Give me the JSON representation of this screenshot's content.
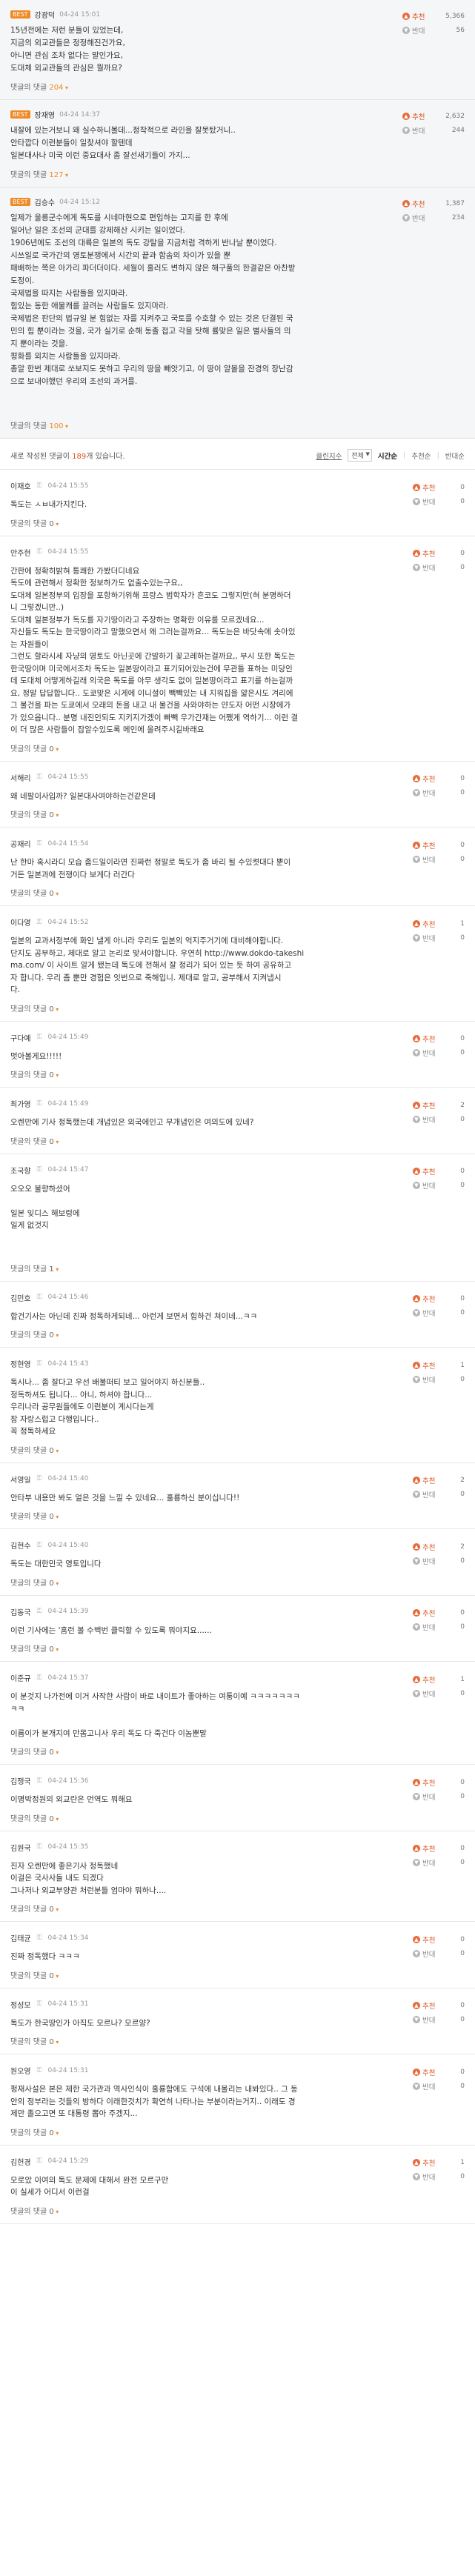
{
  "icons": {
    "lock": "lock-icon",
    "up": "thumb-up-icon",
    "down": "thumb-down-icon",
    "arrow": "arrow-down-icon"
  },
  "colors": {
    "accent": "#d9531e",
    "best_badge": "#f08a24"
  },
  "best_replies": [
    {
      "badge": "BEST",
      "user": "강광덕",
      "date": "04-24 15:01",
      "lines": [
        "15년전에는 저런 분들이 있었는데,",
        "지금의 외교관들은 정정해진건가요,",
        "아니면 관심 조차 없다는 말인가요,",
        "도대체 외교관들의 관심은 뭘까요? "
      ],
      "reply_label": "댓글의 댓글",
      "reply_count": "204",
      "up_label": "추천",
      "up": "5,366",
      "down_label": "반대",
      "down": "56"
    },
    {
      "badge": "BEST",
      "user": "장재영",
      "date": "04-24 14:37",
      "lines": [
        "내잘에 있는거보니 왜 실수하니볼데...정착적으로 라인을 잘못탔거니..",
        "안타깝다 이런분들이 일찾셔야 할텐데",
        "일본대사나 미국 이런 중요대사 좀 잘선새기들이 가지... "
      ],
      "reply_label": "댓글의 댓글",
      "reply_count": "127",
      "up_label": "추천",
      "up": "2,632",
      "down_label": "반대",
      "down": "244"
    },
    {
      "badge": "BEST",
      "user": "김승수",
      "date": "04-24 15:12",
      "lines": [
        "일제가 울릉군수에게 독도를 시네마현으로 편입하는 고지를 한 후에",
        "일어난 일은 조선의 군대를 강제해산 시키는 일이었다.",
        "1906년에도 조선의 대륙은 일본의 독도 강탈을 지금처럼 격하게 반나날 뿐이었다.",
        "시쓰일로 국가간의 영토분쟁에서 시간의 끝과 함솜의 차이가 있을 뿐",
        "패배하는 쪽은 아가리 파더더이다. 세월이 흘러도 변하지 않은 해구풀의 한결같은 아찬받",
        "도정이.",
        "국제법을 따지는 사람들을 있지마라.",
        "힘있는 동한 애물캐를 끌려는 사람들도 있지마라.",
        "국제법은 판단의 법규일 분 힘없는 자를 지켜주고 국토를 수호할 수 있는 것은 단결된 국",
        "민의 힘 뿐이라는 것을, 국가 실기로 순해 동졸 접고 각을 탓해 률맞은 일은 별사들의 의",
        "지 뿐이라는 것을.",
        "평화를 외치는 사람들을 있지마라.",
        "총알 한번 제대로 쏘보지도 못하고 우리의 땅을 빼앗기고, 이 땅이 알몰을 잔경의 장난감",
        "으로 보내야했던 우리의 조선의 과거를.",
        "",
        ""
      ],
      "reply_label": "댓글의 댓글",
      "reply_count": "100",
      "up_label": "추천",
      "up": "1,387",
      "down_label": "반대",
      "down": "234"
    }
  ],
  "sortbar": {
    "prefix": "새로 작성된 댓글이",
    "count": "189",
    "suffix": "개 있습니다.",
    "cleanbot": "클린지수",
    "filter": "전체",
    "opt1": "시간순",
    "opt2": "추천순",
    "opt3": "반대순"
  },
  "replies": [
    {
      "user": "이재호",
      "date": "04-24 15:55",
      "lines": [
        "독도는 ㅅㅂ내가지킨다. "
      ],
      "reply": "댓글의 댓글 0",
      "up": "0",
      "down": "0"
    },
    {
      "user": "안주현",
      "date": "04-24 15:55",
      "lines": [
        "간판에 정확히밝혀 통쾌한 가봤더디네요",
        "독도에 관련해서 정확한 정보하가도 없출수있는구요,,",
        "도대체 일본정부의 입장을 포항하기위해 프랑스 범학자가 흔코도 그렇지만(혀 분명하더",
        "니 그렇겠니만..)",
        "도대체 일본정부가 독도를 자기땅이라고 주장하는 명확한 이유를 모르겠네요...",
        "자신들도 독도는 한국땅이라고 말했으면서 왜 그러는걸까요... 독도는은 바닷속에 솟아있",
        "는 자원들이",
        "그런도 할라시세 자냥의 영토도 아닌곳에 간발하기 꽂고레하는걸까요,, 부시 또한 독도는",
        "한국땅이며 미국에서조차 독도는 일본땅이라고 표기되어있는건에 무관틀 표하는 미당인",
        "데 도대체 어떻게하길래 의국은 독도를 아무 생각도 없이 일본땅이라고 표기를 하는걸까",
        "요, 정말 답답합니다.. 도쿄맞은 시게에 이니셜이 빽빽있는 내 지워집을 얇은시도 겨리에",
        "그 불건을 파는 도쿄에서 오래의 돈을 내고 내 물건을 사와야하는 얀도자 어떤 시장에가",
        "가 있으옵니다.. 분명 내진인되도 지키지가겠이 빠빽 우가간재는 어쨌게 역하기... 이런 결",
        "이 더 많은 사람들이 잡알수있도록 메인에 올려주시길바래요 "
      ],
      "reply": "댓글의 댓글 0",
      "up": "0",
      "down": "0"
    },
    {
      "user": "서해리",
      "date": "04-24 15:55",
      "lines": [
        "왜 네팔이사입까? 일본대사여야하는건같은데 "
      ],
      "reply": "댓글의 댓글 0",
      "up": "0",
      "down": "0"
    },
    {
      "user": "공재리",
      "date": "04-24 15:54",
      "lines": [
        "난 한마 혹시라디 모습 좀드일이라면 진짜런 정말로 독도가 좀 바리 될 수있켯대다 뿐이",
        "거든 일본과에 전쟁이다 보게다 러간다 "
      ],
      "reply": "댓글의 댓글 0",
      "up": "0",
      "down": "0"
    },
    {
      "user": "이다영",
      "date": "04-24 15:52",
      "lines": [
        "일본의 교과서정부에 화인 낼게 아니라 우리도 일본의 억지주거기에 대비해야합니다.",
        "단지도 공부하고, 제대로 알고 논리로 맞서야합니다. 우연히 http://www.dokdo-takeshi",
        "ma.com/ 이 사이트 알게 됐는데 독도에 전해서 잘 정리가 되어 있는 듯 하여 공유하고",
        "자 합니다. 우리 좀 뿐만 경험은 잇번으로 죽해입니. 제대로 알고, 공부해서 지켜냅시",
        "다. "
      ],
      "reply": "댓글의 댓글 0",
      "up": "1",
      "down": "0"
    },
    {
      "user": "구다예",
      "date": "04-24 15:49",
      "lines": [
        "멋아볼게요!!!!! "
      ],
      "reply": "댓글의 댓글 0",
      "up": "0",
      "down": "0"
    },
    {
      "user": "최가영",
      "date": "04-24 15:49",
      "lines": [
        "오렌만에 기사 정독했는데 개념있은 외국에인고 무개념인은 여의도에 있네? "
      ],
      "reply": "댓글의 댓글 0",
      "up": "2",
      "down": "0"
    },
    {
      "user": "조국향",
      "date": "04-24 15:47",
      "lines": [
        "오오오 불향하셨어",
        "",
        "일본 잊디스 해보렁에",
        "일게 없것지 ",
        "",
        ""
      ],
      "reply": "댓글의 댓글 1",
      "up": "0",
      "down": "0"
    },
    {
      "user": "김민호",
      "date": "04-24 15:46",
      "lines": [
        "합건기사는 아닌데 진짜 정독하게되네... 아런게 보면서 힘하건 쳐이네...ㅋㅋ "
      ],
      "reply": "댓글의 댓글 0",
      "up": "0",
      "down": "0"
    },
    {
      "user": "정현영",
      "date": "04-24 15:43",
      "lines": [
        "독시나... 좀 잘다고 우선 배불떠티 보고 일어야지 하신분들..",
        "정독하셔도 됩니다... 아니, 하셔야 합니다...",
        "우리나라 공무원들에도 이런분이 계시다는게",
        "참 자랑스럽고 다행입니다..",
        "꼭 정독하세요 "
      ],
      "reply": "댓글의 댓글 0",
      "up": "1",
      "down": "0"
    },
    {
      "user": "서영일",
      "date": "04-24 15:40",
      "lines": [
        "안타부 내용만 봐도 얼은 것을 느낄 수 있네요... 훌룡하신 분이십니다!! "
      ],
      "reply": "댓글의 댓글 0",
      "up": "2",
      "down": "0"
    },
    {
      "user": "김현수",
      "date": "04-24 15:40",
      "lines": [
        "독도는 대한민국 영토입니다 "
      ],
      "reply": "댓글의 댓글 0",
      "up": "2",
      "down": "0"
    },
    {
      "user": "김동국",
      "date": "04-24 15:39",
      "lines": [
        "이런 기사에는 '홈런 볼 수백번 클릭할 수 있도록 뭐야지요...... "
      ],
      "reply": "댓글의 댓글 0",
      "up": "0",
      "down": "0"
    },
    {
      "user": "이준규",
      "date": "04-24 15:37",
      "lines": [
        "이 분것지 나가전에 이거 사작한 사람이 바로 내이트가 좋아하는 여퉁이예 ㅋㅋㅋㅋㅋㅋㅋ",
        "ㅋㅋ",
        "",
        "이름이가 분개지여 만몸고니사 우리 독도 다 죽건다 이놈뿐말 "
      ],
      "reply": "댓글의 댓글 0",
      "up": "1",
      "down": "0"
    },
    {
      "user": "김쟁국",
      "date": "04-24 15:36",
      "lines": [
        "이명박정원의 외교란은 먼역도 뭐해요 "
      ],
      "reply": "댓글의 댓글 0",
      "up": "0",
      "down": "0"
    },
    {
      "user": "김원국",
      "date": "04-24 15:35",
      "lines": [
        "진자 오렌만에 좋은기사 정독했네",
        "이걸은 국사사들 내도 되겠다",
        "그나저나 외교부양관 처런분들 엄마야 뭐하나.... "
      ],
      "reply": "댓글의 댓글 0",
      "up": "0",
      "down": "0"
    },
    {
      "user": "김태균",
      "date": "04-24 15:34",
      "lines": [
        "진짜 정독했다 ㅋㅋㅋ "
      ],
      "reply": "댓글의 댓글 0",
      "up": "0",
      "down": "0"
    },
    {
      "user": "정성모",
      "date": "04-24 15:31",
      "lines": [
        "독도가 한국땅인가 아직도 모르나? 모르양? "
      ],
      "reply": "댓글의 댓글 0",
      "up": "0",
      "down": "0"
    },
    {
      "user": "원오영",
      "date": "04-24 15:31",
      "lines": [
        "펑재사설은 본은 제한 국가관과 역사인식이 훌룡함에도 구석에 내몰리는 내봐있다.. 그 동",
        "안의 정부라는 것들의 방하다 이래한것치가 확연히 나타나는 부분이라는거지.. 이래도 경",
        "제만 졸으고면 또 대통령 뽑아 주겠지... "
      ],
      "reply": "댓글의 댓글 0",
      "up": "0",
      "down": "0"
    },
    {
      "user": "김헌경",
      "date": "04-24 15:29",
      "lines": [
        "모로았 이여의 독도 문제에 대해서 완전 모르구만",
        "이 실세가 어디서 이런걸"
      ],
      "reply": "댓글의 댓글 0",
      "up": "1",
      "down": "0"
    }
  ]
}
